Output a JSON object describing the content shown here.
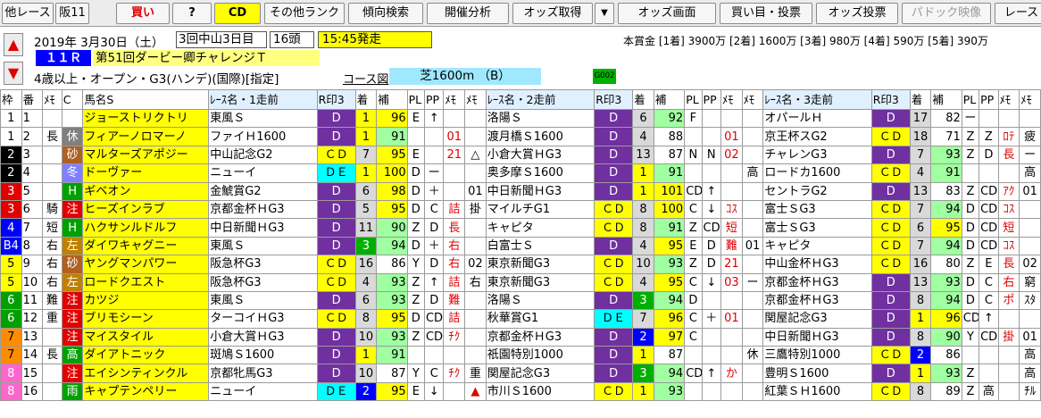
{
  "toolbar": {
    "other_race": "他レース",
    "venue": "阪11",
    "buy": "買い",
    "question": "?",
    "cd": "CD",
    "other_rank": "その他ランク",
    "trend_search": "傾向検索",
    "meeting_analysis": "開催分析",
    "odds_fetch": "オッズ取得",
    "odds_dropdown": "▼",
    "odds_screen": "オッズ画面",
    "bet_vote": "買い目・投票",
    "odds_vote": "オッズ投票",
    "paddock_video": "パドック映像",
    "race": "レース"
  },
  "race": {
    "date": "2019年 3月30日（土）",
    "meeting": "3回中山3日目",
    "heads": "16頭",
    "start_time": "15:45発走",
    "prize": "本賞金 [1着] 3900万 [2着] 1600万 [3着] 980万 [4着] 590万 [5着] 390万",
    "race_no": "１１Ｒ",
    "name": "第51回ダービー卿チャレンジＴ",
    "conditions": "4歳以上・オープン・G3(ハンデ)(国際)[指定]",
    "course_label": "コース図",
    "course": "芝1600m （B）",
    "code": "G002",
    "prev_arrow": "▲",
    "next_arrow": "▼"
  },
  "columns": [
    "枠",
    "番",
    "ﾒﾓ",
    "C",
    "馬名S",
    "ﾚｰｽ名・1走前",
    "R印3",
    "着",
    "補",
    "PL",
    "PP",
    "ﾒﾓ",
    "ﾒﾓ",
    "ﾚｰｽ名・2走前",
    "R印3",
    "着",
    "補",
    "PL",
    "PP",
    "ﾒﾓ",
    "ﾒﾓ",
    "ﾚｰｽ名・3走前",
    "R印3",
    "着",
    "補",
    "PL",
    "PP",
    "ﾒﾓ",
    "ﾒﾓ"
  ],
  "rows": [
    {
      "waku": "1",
      "num": "1",
      "memo": "",
      "mark": "",
      "name": "ジョーストリクトリ",
      "r1": {
        "race": "東風Ｓ",
        "ri": "D",
        "pos": "1",
        "ho": "96",
        "pl": "E",
        "pp": "↑",
        "m1": "",
        "m2": ""
      },
      "r2": {
        "race": "洛陽Ｓ",
        "ri": "D",
        "pos": "6",
        "ho": "92",
        "pl": "F",
        "pp": "",
        "m1": "",
        "m2": ""
      },
      "r3": {
        "race": "オパールＨ",
        "ri": "D",
        "pos": "17",
        "ho": "82",
        "pl": "ー",
        "pp": "",
        "m1": "",
        "m2": ""
      }
    },
    {
      "waku": "1",
      "num": "2",
      "memo": "長",
      "mark": "休",
      "name": "フィアーノロマーノ",
      "r1": {
        "race": "ファイＨ1600",
        "ri": "D",
        "pos": "1",
        "ho": "91",
        "pl": "",
        "pp": "",
        "m1": "01",
        "m2": ""
      },
      "r2": {
        "race": "渡月橋Ｓ1600",
        "ri": "D",
        "pos": "4",
        "ho": "88",
        "pl": "",
        "pp": "",
        "m1": "01",
        "m2": ""
      },
      "r3": {
        "race": "京王杯スG2",
        "ri": "ＣＤ",
        "pos": "18",
        "ho": "71",
        "pl": "Z",
        "pp": "Z",
        "m1": "ﾛﾃ",
        "m2": "疲"
      }
    },
    {
      "waku": "2",
      "num": "3",
      "memo": "",
      "mark": "砂",
      "name": "マルターズアポジー",
      "r1": {
        "race": "中山記念G2",
        "ri": "ＣＤ",
        "pos": "7",
        "ho": "95",
        "pl": "E",
        "pp": "",
        "m1": "21",
        "m2": "△"
      },
      "r2": {
        "race": "小倉大賞ＨG3",
        "ri": "D",
        "pos": "13",
        "ho": "87",
        "pl": "N",
        "pp": "N",
        "m1": "02",
        "m2": ""
      },
      "r3": {
        "race": "チャレンG3",
        "ri": "D",
        "pos": "7",
        "ho": "93",
        "pl": "Z",
        "pp": "D",
        "m1": "長",
        "m2": "ー"
      }
    },
    {
      "waku": "2",
      "num": "4",
      "memo": "",
      "mark": "冬",
      "name": "ドーヴァー",
      "r1": {
        "race": "ニューイ",
        "ri": "ＤＥ",
        "pos": "1",
        "ho": "100",
        "pl": "D",
        "pp": "ー",
        "m1": "",
        "m2": ""
      },
      "r2": {
        "race": "奥多摩Ｓ1600",
        "ri": "D",
        "pos": "1",
        "ho": "91",
        "pl": "",
        "pp": "",
        "m1": "",
        "m2": "高"
      },
      "r3": {
        "race": "ロードカ1600",
        "ri": "ＣＤ",
        "pos": "4",
        "ho": "91",
        "pl": "",
        "pp": "",
        "m1": "",
        "m2": "高"
      }
    },
    {
      "waku": "3",
      "num": "5",
      "memo": "",
      "mark": "H",
      "name": "ギベオン",
      "r1": {
        "race": "金鯱賞G2",
        "ri": "D",
        "pos": "6",
        "ho": "98",
        "pl": "D",
        "pp": "＋",
        "m1": "",
        "m2": "01"
      },
      "r2": {
        "race": "中日新聞ＨG3",
        "ri": "D",
        "pos": "1",
        "ho": "101",
        "pl": "CD",
        "pp": "↑",
        "m1": "",
        "m2": ""
      },
      "r3": {
        "race": "セントラG2",
        "ri": "D",
        "pos": "13",
        "ho": "83",
        "pl": "Z",
        "pp": "CD",
        "m1": "ｱｸ",
        "m2": "01"
      }
    },
    {
      "waku": "3",
      "num": "6",
      "memo": "騎",
      "mark": "注",
      "name": "ヒーズインラブ",
      "r1": {
        "race": "京都金杯ＨG3",
        "ri": "D",
        "pos": "5",
        "ho": "95",
        "pl": "D",
        "pp": "C",
        "m1": "詰",
        "m2": "掛"
      },
      "r2": {
        "race": "マイルチG1",
        "ri": "ＣＤ",
        "pos": "8",
        "ho": "100",
        "pl": "C",
        "pp": "↓",
        "m1": "ｺｽ",
        "m2": ""
      },
      "r3": {
        "race": "富士ＳG3",
        "ri": "ＣＤ",
        "pos": "7",
        "ho": "94",
        "pl": "D",
        "pp": "CD",
        "m1": "ｺｽ",
        "m2": ""
      }
    },
    {
      "waku": "4",
      "num": "7",
      "memo": "短",
      "mark": "H",
      "name": "ハクサンルドルフ",
      "r1": {
        "race": "中日新聞ＨG3",
        "ri": "D",
        "pos": "11",
        "ho": "90",
        "pl": "Z",
        "pp": "D",
        "m1": "長",
        "m2": ""
      },
      "r2": {
        "race": "キャピタ",
        "ri": "ＣＤ",
        "pos": "8",
        "ho": "91",
        "pl": "Z",
        "pp": "CD",
        "m1": "短",
        "m2": ""
      },
      "r3": {
        "race": "富士ＳG3",
        "ri": "ＣＤ",
        "pos": "6",
        "ho": "95",
        "pl": "D",
        "pp": "CD",
        "m1": "短",
        "m2": ""
      }
    },
    {
      "waku": "B4",
      "num": "8",
      "memo": "右",
      "mark": "左",
      "name": "ダイワキャグニー",
      "r1": {
        "race": "東風Ｓ",
        "ri": "D",
        "pos": "3",
        "ho": "94",
        "pl": "D",
        "pp": "＋",
        "m1": "右",
        "m2": ""
      },
      "r2": {
        "race": "白富士Ｓ",
        "ri": "D",
        "pos": "4",
        "ho": "95",
        "pl": "E",
        "pp": "D",
        "m1": "難",
        "m2": "01"
      },
      "r3": {
        "race": "キャピタ",
        "ri": "ＣＤ",
        "pos": "7",
        "ho": "94",
        "pl": "D",
        "pp": "CD",
        "m1": "ｺｽ",
        "m2": ""
      }
    },
    {
      "waku": "5",
      "num": "9",
      "memo": "右",
      "mark": "砂",
      "name": "ヤングマンパワー",
      "r1": {
        "race": "阪急杯G3",
        "ri": "ＣＤ",
        "pos": "16",
        "ho": "86",
        "pl": "Y",
        "pp": "D",
        "m1": "右",
        "m2": "02"
      },
      "r2": {
        "race": "東京新聞G3",
        "ri": "ＣＤ",
        "pos": "10",
        "ho": "93",
        "pl": "Z",
        "pp": "D",
        "m1": "21",
        "m2": ""
      },
      "r3": {
        "race": "中山金杯ＨG3",
        "ri": "ＣＤ",
        "pos": "16",
        "ho": "80",
        "pl": "Z",
        "pp": "E",
        "m1": "長",
        "m2": "02"
      }
    },
    {
      "waku": "5",
      "num": "10",
      "memo": "右",
      "mark": "左",
      "name": "ロードクエスト",
      "r1": {
        "race": "阪急杯G3",
        "ri": "ＣＤ",
        "pos": "4",
        "ho": "93",
        "pl": "Z",
        "pp": "↑",
        "m1": "詰",
        "m2": "右"
      },
      "r2": {
        "race": "東京新聞G3",
        "ri": "ＣＤ",
        "pos": "4",
        "ho": "95",
        "pl": "C",
        "pp": "↓",
        "m1": "03",
        "m2": "ー"
      },
      "r3": {
        "race": "京都金杯ＨG3",
        "ri": "D",
        "pos": "13",
        "ho": "93",
        "pl": "D",
        "pp": "C",
        "m1": "右",
        "m2": "窮"
      }
    },
    {
      "waku": "6",
      "num": "11",
      "memo": "難",
      "mark": "注",
      "name": "カツジ",
      "r1": {
        "race": "東風Ｓ",
        "ri": "D",
        "pos": "6",
        "ho": "93",
        "pl": "Z",
        "pp": "D",
        "m1": "難",
        "m2": ""
      },
      "r2": {
        "race": "洛陽Ｓ",
        "ri": "D",
        "pos": "3",
        "ho": "94",
        "pl": "D",
        "pp": "",
        "m1": "",
        "m2": ""
      },
      "r3": {
        "race": "京都金杯ＨG3",
        "ri": "D",
        "pos": "8",
        "ho": "94",
        "pl": "D",
        "pp": "C",
        "m1": "ポ",
        "m2": "ｽﾀ"
      }
    },
    {
      "waku": "6",
      "num": "12",
      "memo": "重",
      "mark": "注",
      "name": "ブリモシーン",
      "r1": {
        "race": "ターコイＨG3",
        "ri": "ＣＤ",
        "pos": "8",
        "ho": "95",
        "pl": "D",
        "pp": "CD",
        "m1": "詰",
        "m2": ""
      },
      "r2": {
        "race": "秋華賞G1",
        "ri": "ＤＥ",
        "pos": "7",
        "ho": "96",
        "pl": "C",
        "pp": "＋",
        "m1": "01",
        "m2": ""
      },
      "r3": {
        "race": "関屋記念G3",
        "ri": "D",
        "pos": "1",
        "ho": "96",
        "pl": "CD",
        "pp": "↑",
        "m1": "",
        "m2": ""
      }
    },
    {
      "waku": "7",
      "num": "13",
      "memo": "",
      "mark": "注",
      "name": "マイスタイル",
      "r1": {
        "race": "小倉大賞ＨG3",
        "ri": "D",
        "pos": "10",
        "ho": "93",
        "pl": "Z",
        "pp": "CD",
        "m1": "ﾁｸ",
        "m2": ""
      },
      "r2": {
        "race": "京都金杯ＨG3",
        "ri": "D",
        "pos": "2",
        "ho": "97",
        "pl": "C",
        "pp": "",
        "m1": "",
        "m2": ""
      },
      "r3": {
        "race": "中日新聞ＨG3",
        "ri": "D",
        "pos": "8",
        "ho": "90",
        "pl": "Y",
        "pp": "CD",
        "m1": "掛",
        "m2": "01"
      }
    },
    {
      "waku": "7",
      "num": "14",
      "memo": "長",
      "mark": "高",
      "name": "ダイアトニック",
      "r1": {
        "race": "斑鳩Ｓ1600",
        "ri": "D",
        "pos": "1",
        "ho": "91",
        "pl": "",
        "pp": "",
        "m1": "",
        "m2": ""
      },
      "r2": {
        "race": "祇園特別1000",
        "ri": "D",
        "pos": "1",
        "ho": "87",
        "pl": "",
        "pp": "",
        "m1": "",
        "m2": "休"
      },
      "r3": {
        "race": "三鷹特別1000",
        "ri": "ＣＤ",
        "pos": "2",
        "ho": "86",
        "pl": "",
        "pp": "",
        "m1": "",
        "m2": "高"
      }
    },
    {
      "waku": "8",
      "num": "15",
      "memo": "",
      "mark": "注",
      "name": "エイシンティンクル",
      "r1": {
        "race": "京都牝馬G3",
        "ri": "D",
        "pos": "10",
        "ho": "87",
        "pl": "Y",
        "pp": "C",
        "m1": "ﾁｸ",
        "m2": "重"
      },
      "r2": {
        "race": "関屋記念G3",
        "ri": "D",
        "pos": "3",
        "ho": "94",
        "pl": "CD",
        "pp": "↑",
        "m1": "か",
        "m2": ""
      },
      "r3": {
        "race": "豊明Ｓ1600",
        "ri": "D",
        "pos": "1",
        "ho": "93",
        "pl": "Z",
        "pp": "",
        "m1": "",
        "m2": "高"
      }
    },
    {
      "waku": "8",
      "num": "16",
      "memo": "",
      "mark": "雨",
      "name": "キャプテンペリー",
      "r1": {
        "race": "ニューイ",
        "ri": "ＤＥ",
        "pos": "2",
        "ho": "95",
        "pl": "E",
        "pp": "↓",
        "m1": "",
        "m2": "▲"
      },
      "r2": {
        "race": "市川Ｓ1600",
        "ri": "ＣＤ",
        "pos": "1",
        "ho": "93",
        "pl": "",
        "pp": "",
        "m1": "",
        "m2": ""
      },
      "r3": {
        "race": "紅葉ＳＨ1600",
        "ri": "ＣＤ",
        "pos": "8",
        "ho": "89",
        "pl": "Z",
        "pp": "高",
        "m1": "",
        "m2": "ﾁﾙ"
      }
    }
  ],
  "colors": {
    "yellow": "#ffff00",
    "cyan": "#00ffff",
    "purple": "#7030a0",
    "mark_red": "#e00000",
    "mark_green": "#008000",
    "grey": "#d9d9d9",
    "blue_pos": "#0000ff",
    "red_pos": "#ff0000",
    "header_blue": "#c0e0ff"
  }
}
